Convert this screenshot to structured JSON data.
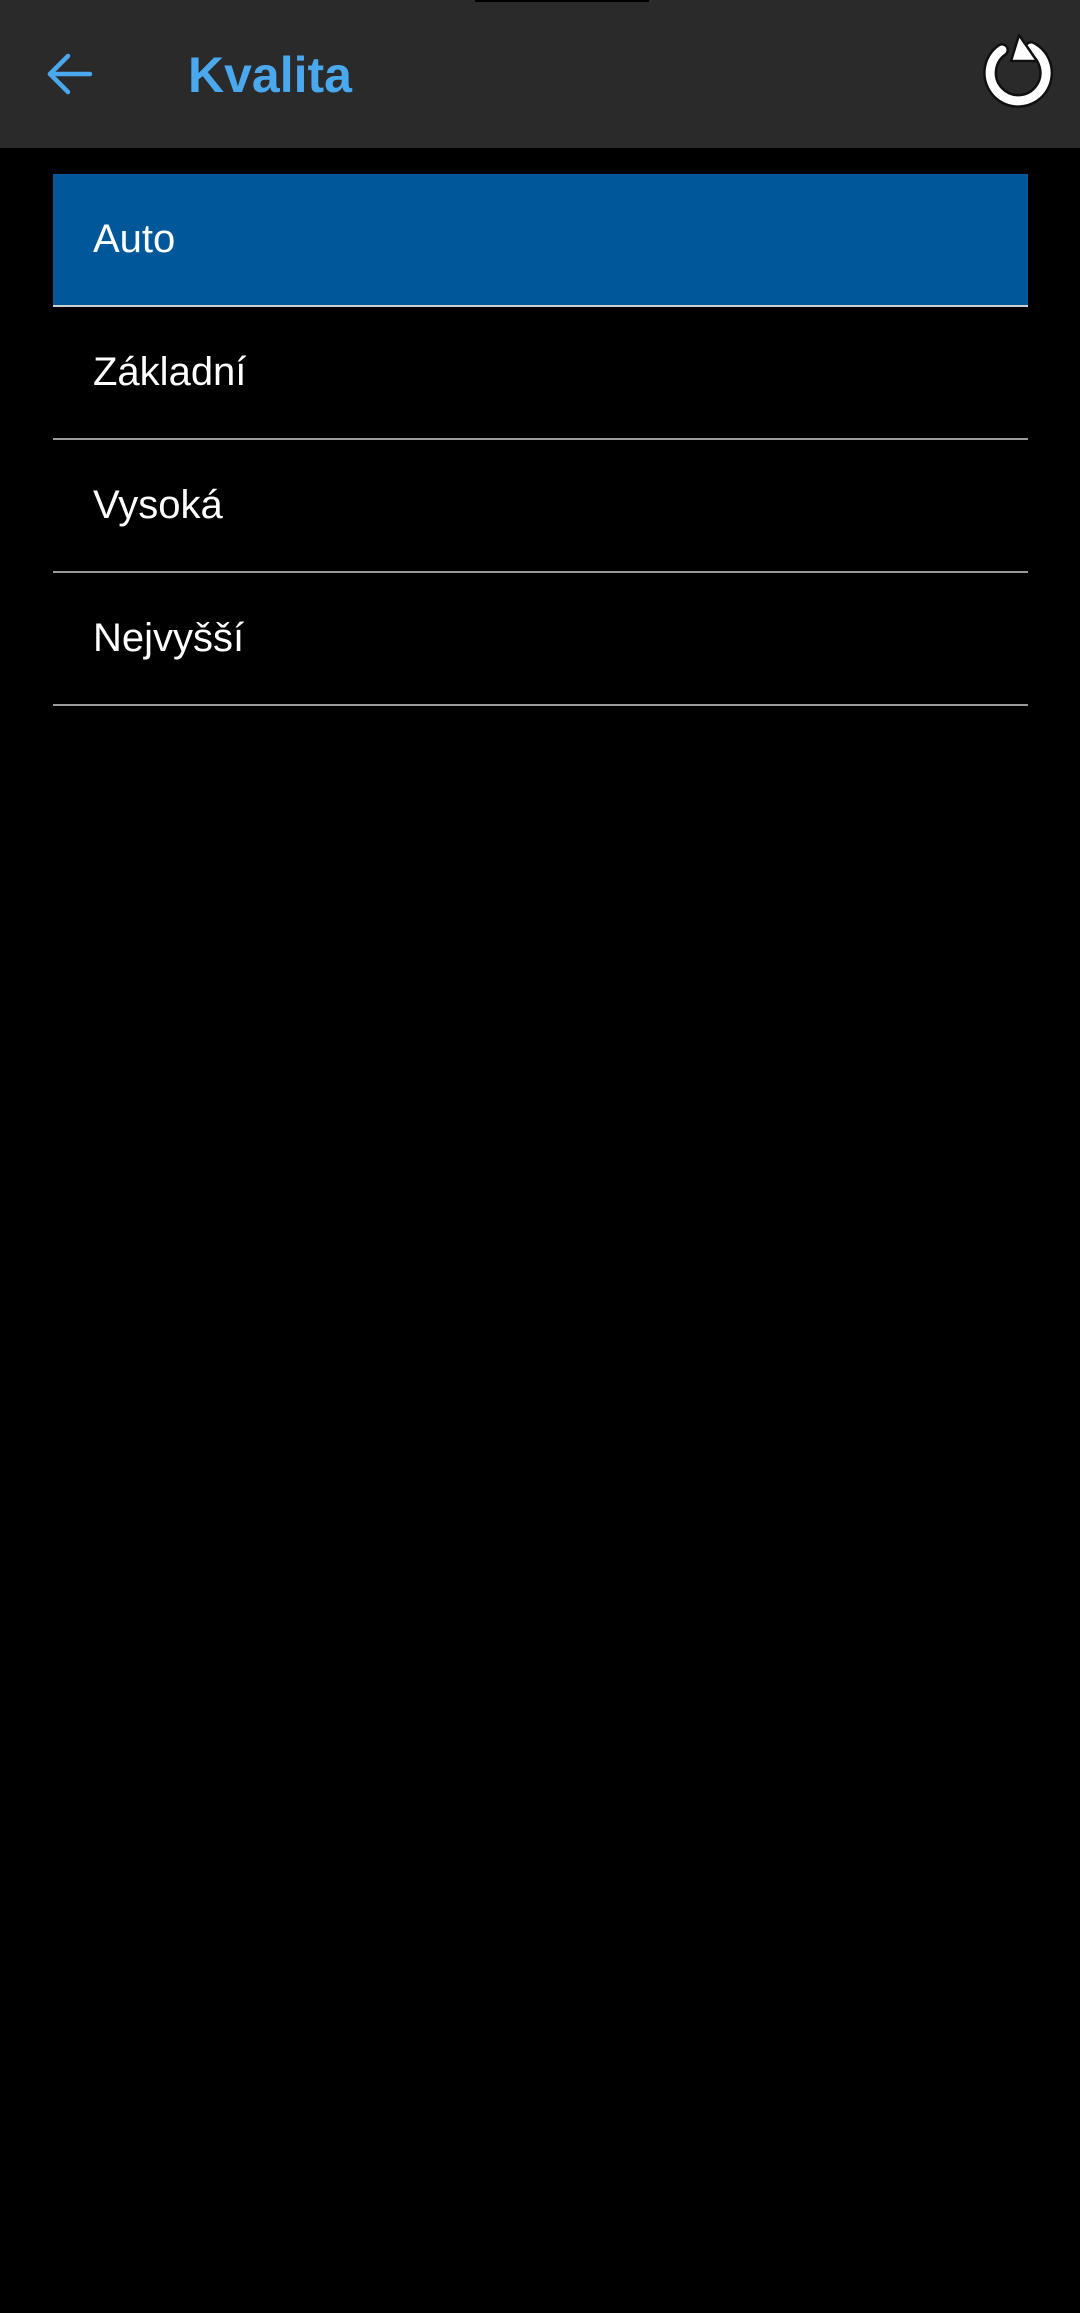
{
  "header": {
    "title": "Kvalita",
    "back_icon": "arrow-left-icon",
    "refresh_icon": "refresh-icon",
    "accent_color": "#4aa8ee",
    "background_color": "#2a2a2a"
  },
  "options": {
    "selected_index": 0,
    "selected_color": "#005799",
    "items": [
      {
        "label": "Auto"
      },
      {
        "label": "Základní"
      },
      {
        "label": "Vysoká"
      },
      {
        "label": "Nejvyšší"
      }
    ]
  }
}
